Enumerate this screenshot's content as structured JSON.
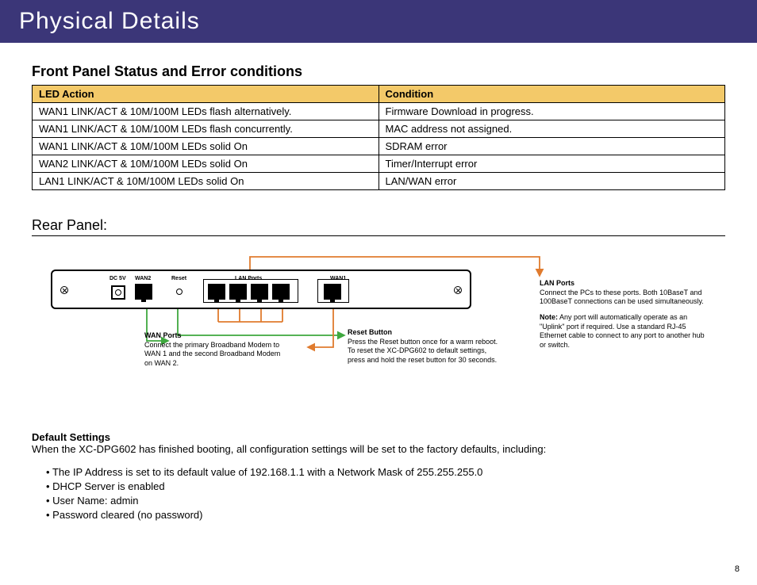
{
  "header": {
    "title": "Physical Details"
  },
  "front_panel": {
    "heading": "Front Panel Status and Error conditions",
    "columns": {
      "led": "LED Action",
      "cond": "Condition"
    },
    "rows": [
      {
        "led": "WAN1 LINK/ACT & 10M/100M LEDs flash alternatively.",
        "cond": "Firmware Download in progress."
      },
      {
        "led": "WAN1 LINK/ACT & 10M/100M LEDs flash concurrently.",
        "cond": "MAC address not assigned."
      },
      {
        "led": "WAN1 LINK/ACT & 10M/100M LEDs solid On",
        "cond": "SDRAM error"
      },
      {
        "led": "WAN2 LINK/ACT & 10M/100M LEDs solid On",
        "cond": "Timer/Interrupt error"
      },
      {
        "led": "LAN1 LINK/ACT & 10M/100M LEDs solid On",
        "cond": "LAN/WAN error"
      }
    ]
  },
  "rear_panel": {
    "heading": "Rear Panel:",
    "labels": {
      "dc": "DC 5V",
      "wan2": "WAN2",
      "reset": "Reset",
      "lan": "LAN Ports",
      "wan1": "WAN1"
    },
    "callouts": {
      "wan": {
        "title": "WAN Ports",
        "body": "Connect the primary Broadband Modem to WAN 1 and the second Broadband Modem on WAN 2."
      },
      "reset": {
        "title": "Reset Button",
        "body": "Press the Reset button once for a warm reboot.  To reset the XC-DPG602 to default settings, press and hold the reset button for 30 seconds."
      },
      "lan": {
        "title": "LAN Ports",
        "body": "Connect the PCs to these ports. Both 10BaseT and 100BaseT connections can be used simultaneously."
      },
      "note_label": "Note:",
      "note_body": "Any port will automatically operate as an \"Uplink\" port if required. Use a standard RJ-45 Ethernet cable to connect to any port to another hub or switch."
    }
  },
  "defaults": {
    "heading": "Default Settings",
    "intro": "When the XC-DPG602 has finished booting, all configuration settings will be set to the factory defaults, including:",
    "items": [
      "The IP Address is set to its default value of 192.168.1.1 with a Network Mask of 255.255.255.0",
      "DHCP Server is enabled",
      "User Name: admin",
      "Password cleared (no password)"
    ]
  },
  "page_number": "8"
}
